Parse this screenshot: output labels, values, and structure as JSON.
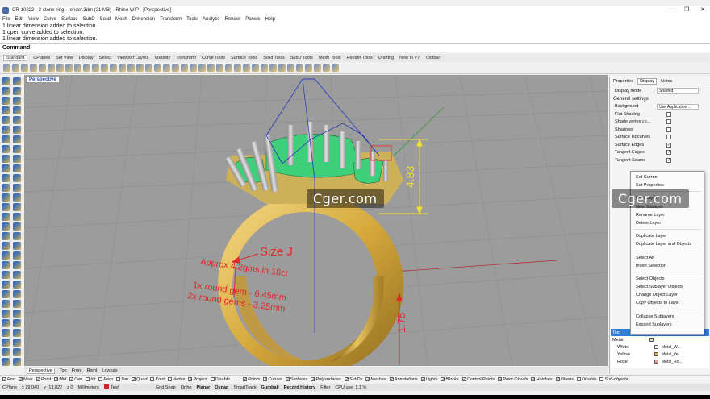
{
  "window": {
    "title": "CR-10222 - 3-stone ring - render.3dm (21 MB) - Rhino WIP - [Perspective]",
    "controls": [
      "—",
      "❐",
      "✕"
    ]
  },
  "menu": [
    "File",
    "Edit",
    "View",
    "Curve",
    "Surface",
    "SubD",
    "Solid",
    "Mesh",
    "Dimension",
    "Transform",
    "Tools",
    "Analyze",
    "Render",
    "Panels",
    "Help"
  ],
  "history": [
    "1 linear dimension added to selection.",
    "1 open curve added to selection.",
    "1 linear dimension added to selection."
  ],
  "command_label": "Command:",
  "toolbar_tabs": [
    "Standard",
    "CPlanes",
    "Set View",
    "Display",
    "Select",
    "Viewport Layout",
    "Visibility",
    "Transform",
    "Curve Tools",
    "Surface Tools",
    "Solid Tools",
    "SubD Tools",
    "Mesh Tools",
    "Render Tools",
    "Drafting",
    "New in V7",
    "Toolbar"
  ],
  "viewport": {
    "label": "Perspective",
    "annotations": {
      "size": "Size J",
      "dim_top": "4.83",
      "dim_bottom": "1.75",
      "note1": "Approx 4.2gms in 18ct",
      "note2": "1x round gem - 6.45mm",
      "note3": "2x round gems - 3.25mm"
    }
  },
  "view_tabs": [
    "Perspective",
    "Top",
    "Front",
    "Right",
    "Layouts"
  ],
  "right_panel": {
    "tabs": [
      "Properties",
      "Display",
      "Notes"
    ],
    "display_mode_label": "Display mode",
    "display_mode_value": "Shaded",
    "general_settings": "General settings",
    "rows": [
      {
        "label": "Background",
        "value": "Use Application ..."
      },
      {
        "label": "Flat Shading",
        "checked": false
      },
      {
        "label": "Shade vertex co...",
        "checked": false
      },
      {
        "label": "Shadows",
        "checked": false
      },
      {
        "label": "Surface Isocurves",
        "checked": false
      },
      {
        "label": "Surface Edges",
        "checked": true
      },
      {
        "label": "Tangent Edges",
        "checked": true
      },
      {
        "label": "Tangent Seams",
        "checked": true
      }
    ]
  },
  "context_menu": [
    "Set Current",
    "Set Properties",
    "",
    "New Layer",
    "New Sublayer",
    "Rename Layer",
    "Delete Layer",
    "",
    "Duplicate Layer",
    "Duplicate Layer and Objects",
    "",
    "Select All",
    "Invert Selection",
    "",
    "Select Objects",
    "Select Sublayer Objects",
    "Change Object Layer",
    "Copy Objects to Layer",
    "",
    "Collapse Sublayers",
    "Expand Sublayers"
  ],
  "layers": [
    {
      "name": "Text",
      "selected": true,
      "color": "#000000",
      "material": ""
    },
    {
      "name": "Metal",
      "selected": false,
      "color": "#e0e0e0",
      "material": ""
    },
    {
      "name": "White",
      "selected": false,
      "color": "#ffffff",
      "material": "Metal_W..."
    },
    {
      "name": "Yellow",
      "selected": false,
      "color": "#e5b54a",
      "material": "Metal_Ye..."
    },
    {
      "name": "Rose",
      "selected": false,
      "color": "#e8a090",
      "material": "Metal_Ro..."
    }
  ],
  "osnap": [
    {
      "label": "End",
      "checked": true
    },
    {
      "label": "Near",
      "checked": true
    },
    {
      "label": "Point",
      "checked": true
    },
    {
      "label": "Mid",
      "checked": true
    },
    {
      "label": "Cen",
      "checked": true
    },
    {
      "label": "Int",
      "checked": false
    },
    {
      "label": "Perp",
      "checked": false
    },
    {
      "label": "Tan",
      "checked": false
    },
    {
      "label": "Quad",
      "checked": true
    },
    {
      "label": "Knot",
      "checked": false
    },
    {
      "label": "Vertex",
      "checked": false
    },
    {
      "label": "Project",
      "checked": true
    },
    {
      "label": "Disable",
      "checked": false
    },
    {
      "label": "Points",
      "checked": true
    },
    {
      "label": "Curves",
      "checked": true
    },
    {
      "label": "Surfaces",
      "checked": true
    },
    {
      "label": "Polysurfaces",
      "checked": true
    },
    {
      "label": "SubDs",
      "checked": true
    },
    {
      "label": "Meshes",
      "checked": true
    },
    {
      "label": "Annotations",
      "checked": true
    },
    {
      "label": "Lights",
      "checked": true
    },
    {
      "label": "Blocks",
      "checked": true
    },
    {
      "label": "Control Points",
      "checked": true
    },
    {
      "label": "Point Clouds",
      "checked": true
    },
    {
      "label": "Hatches",
      "checked": true
    },
    {
      "label": "Others",
      "checked": true
    },
    {
      "label": "Disable",
      "checked": false
    },
    {
      "label": "Sub-objects",
      "checked": false
    }
  ],
  "status": {
    "cplane": "CPlane",
    "x": "x 29.040",
    "y": "y -13.022",
    "z": "z 0",
    "units": "Millimeters",
    "layer": "Text",
    "toggles": [
      "Grid Snap",
      "Ortho",
      "Planar",
      "Osnap",
      "SmartTrack",
      "Gumball",
      "Record History",
      "Filter"
    ],
    "cpu": "CPU use: 1.1 %"
  },
  "watermarks": [
    "Cger.com",
    "Cger.com"
  ]
}
